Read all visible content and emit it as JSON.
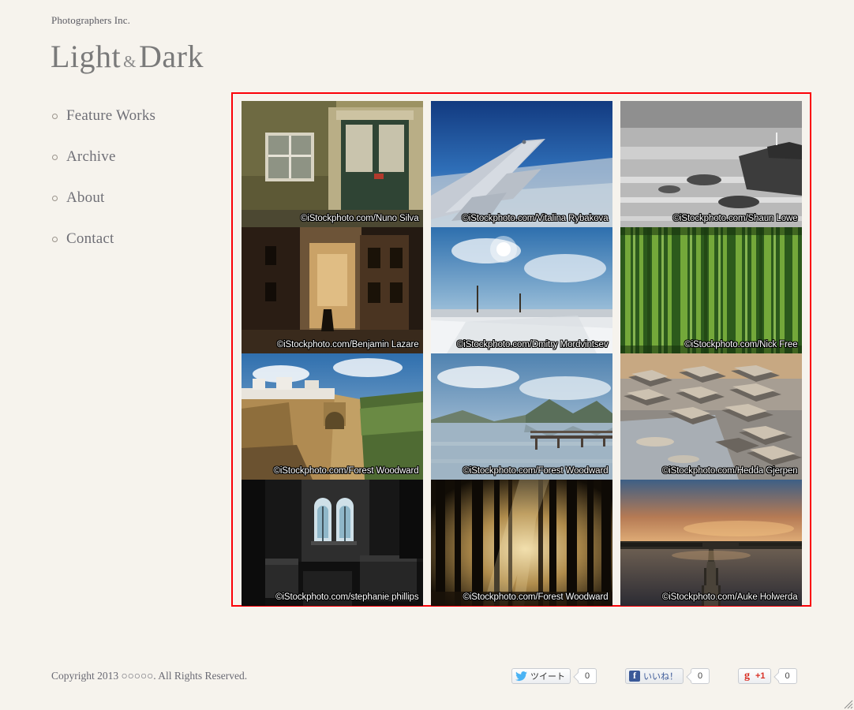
{
  "header": {
    "eyebrow": "Photographers Inc.",
    "title_left": "Light",
    "title_amp": "&",
    "title_right": "Dark"
  },
  "nav": {
    "items": [
      {
        "label": "Feature Works",
        "icon": "circle-bullet-icon"
      },
      {
        "label": "Archive",
        "icon": "circle-bullet-icon"
      },
      {
        "label": "About",
        "icon": "circle-bullet-icon"
      },
      {
        "label": "Contact",
        "icon": "circle-bullet-icon"
      }
    ]
  },
  "gallery": {
    "border_color": "#fb0007",
    "columns": 3,
    "rows": 4,
    "items": [
      {
        "caption": "©iStockphoto.com/Nuno Silva",
        "subject": "weathered-wall-window-and-green-door"
      },
      {
        "caption": "©iStockphoto.com/Vitalina Rybakova",
        "subject": "airplane-wing-above-clouds"
      },
      {
        "caption": "©iStockphoto.com/Shaun Lowe",
        "subject": "black-and-white-rocky-coastline"
      },
      {
        "caption": "©iStockphoto.com/Benjamin Lazare",
        "subject": "narrow-old-town-alley-at-dusk"
      },
      {
        "caption": "©iStockphoto.com/Dmitry Mordvintsev",
        "subject": "sun-over-snowy-field"
      },
      {
        "caption": "©iStockphoto.com/Nick Free",
        "subject": "green-bamboo-forest"
      },
      {
        "caption": "©iStockphoto.com/Forest Woodward",
        "subject": "cliffside-town-with-stone-bridge"
      },
      {
        "caption": "©iStockphoto.com/Forest Woodward",
        "subject": "mountain-lake-with-wooden-pier"
      },
      {
        "caption": "©iStockphoto.com/Hedda Gjerpen",
        "subject": "cracked-dry-mud-flats-with-water"
      },
      {
        "caption": "©iStockphoto.com/stephanie phillips",
        "subject": "dark-church-interior-stained-glass"
      },
      {
        "caption": "©iStockphoto.com/Forest Woodward",
        "subject": "sunbeams-through-forest-trees"
      },
      {
        "caption": "©iStockphoto.com/Auke Holwerda",
        "subject": "sunset-lake-jetty"
      }
    ]
  },
  "footer": {
    "copyright": "Copyright 2013 ○○○○○. All Rights Reserved.",
    "social": [
      {
        "name": "twitter",
        "label": "ツイート",
        "count": "0",
        "icon": "twitter-bird-icon"
      },
      {
        "name": "facebook",
        "label": "いいね！",
        "count": "0",
        "icon": "facebook-f-icon"
      },
      {
        "name": "googleplus",
        "label": "+1",
        "count": "0",
        "icon": "google-plus-icon"
      }
    ]
  }
}
